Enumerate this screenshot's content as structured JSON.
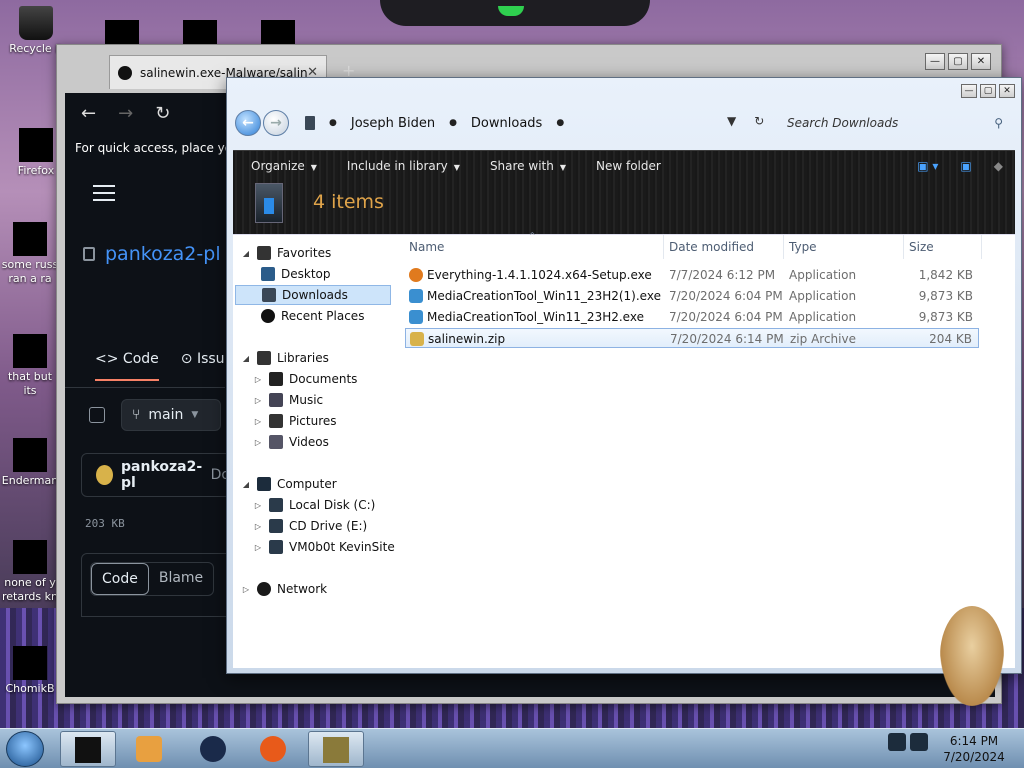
{
  "desktop": {
    "icons": [
      {
        "label": "Recycle B"
      },
      {
        "label": "Firefox"
      },
      {
        "label": "some russ ran a ra"
      },
      {
        "label": "that but its"
      },
      {
        "label": "Enderman"
      },
      {
        "label": "none of y retards kn"
      },
      {
        "label": "ChomikB"
      }
    ]
  },
  "browser": {
    "tab_title": "salinewin.exe-Malware/salinew",
    "quick_access": "For quick access, place your",
    "repo": "pankoza2-pl /",
    "tabs": [
      "Code",
      "Issu"
    ],
    "branch": "main",
    "author": "pankoza2-pl",
    "author_extra": "Do",
    "file_size": "203 KB",
    "code_btn": "Code",
    "blame_btn": "Blame"
  },
  "explorer": {
    "breadcrumbs": [
      "Joseph Biden",
      "Downloads"
    ],
    "search_placeholder": "Search Downloads",
    "toolbar": {
      "organize": "Organize",
      "include": "Include in library",
      "share": "Share with",
      "new_folder": "New folder"
    },
    "item_count": "4 items",
    "nav": {
      "favorites": "Favorites",
      "desktop": "Desktop",
      "downloads": "Downloads",
      "recent": "Recent Places",
      "libraries": "Libraries",
      "documents": "Documents",
      "music": "Music",
      "pictures": "Pictures",
      "videos": "Videos",
      "computer": "Computer",
      "local_disk": "Local Disk (C:)",
      "cd_drive": "CD Drive (E:)",
      "vm": "VM0b0t KevinSite",
      "network": "Network"
    },
    "columns": {
      "name": "Name",
      "date": "Date modified",
      "type": "Type",
      "size": "Size"
    },
    "files": [
      {
        "name": "Everything-1.4.1.1024.x64-Setup.exe",
        "date": "7/7/2024 6:12 PM",
        "type": "Application",
        "size": "1,842 KB",
        "icon_color": "#e07a1e"
      },
      {
        "name": "MediaCreationTool_Win11_23H2(1).exe",
        "date": "7/20/2024 6:04 PM",
        "type": "Application",
        "size": "9,873 KB",
        "icon_color": "#3a8fd0"
      },
      {
        "name": "MediaCreationTool_Win11_23H2.exe",
        "date": "7/20/2024 6:04 PM",
        "type": "Application",
        "size": "9,873 KB",
        "icon_color": "#3a8fd0"
      },
      {
        "name": "salinewin.zip",
        "date": "7/20/2024 6:14 PM",
        "type": "zip Archive",
        "size": "204 KB",
        "icon_color": "#d8b24a"
      }
    ]
  },
  "taskbar": {
    "time": "6:14 PM",
    "date": "7/20/2024"
  }
}
